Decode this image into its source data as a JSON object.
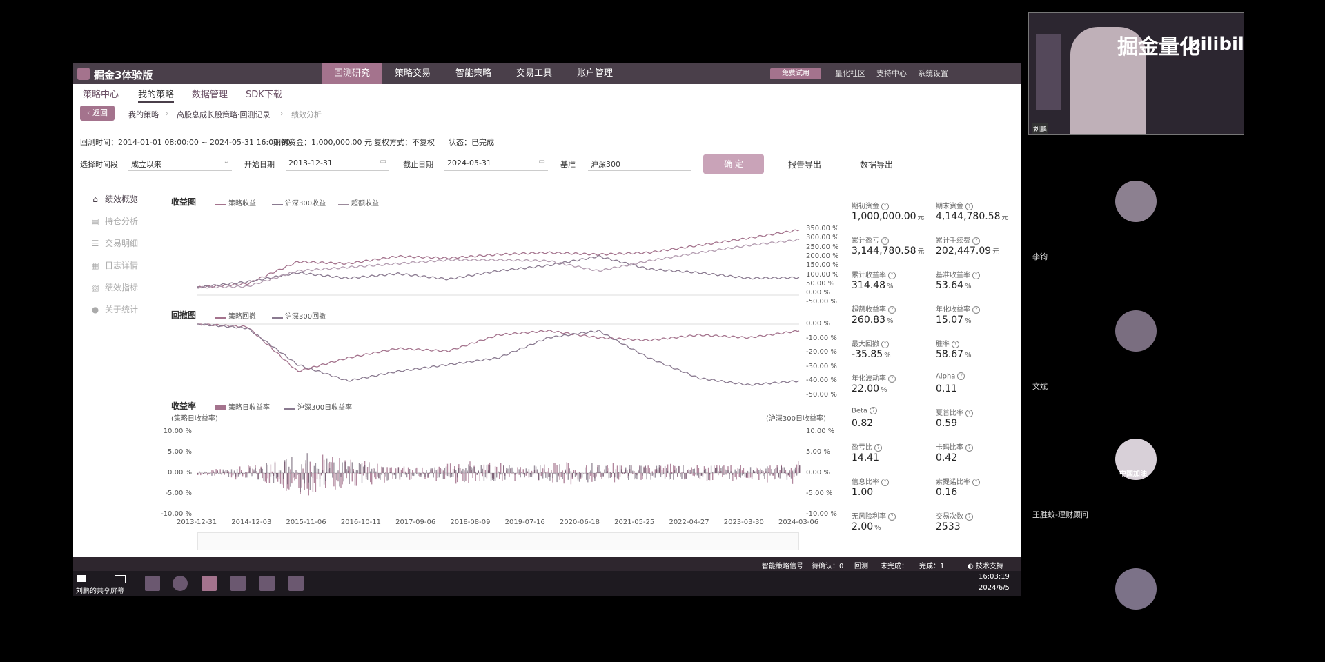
{
  "app": {
    "title": "掘金3体验版",
    "nav": [
      "回测研究",
      "策略交易",
      "智能策略",
      "交易工具",
      "账户管理"
    ],
    "live_button": "免费试用",
    "top_links": [
      "量化社区",
      "支持中心",
      "系统设置"
    ]
  },
  "subnav": [
    "策略中心",
    "我的策略",
    "数据管理",
    "SDK下载"
  ],
  "back_label": "返回",
  "breadcrumb": [
    "我的策略",
    "高股息成长股策略·回测记录",
    "绩效分析"
  ],
  "info": {
    "period": "回测时间：2014-01-01 08:00:00 ~ 2024-05-31 16:00:00",
    "capital": "期初资金：1,000,000.00 元",
    "reinvest": "复权方式：不复权",
    "status": "状态：已完成"
  },
  "filters": {
    "range_label": "选择时间段",
    "range_value": "成立以来",
    "start_label": "开始日期",
    "start_value": "2013-12-31",
    "end_label": "截止日期",
    "end_value": "2024-05-31",
    "bench_label": "基准",
    "bench_value": "沪深300",
    "ok": "确 定",
    "export_report": "报告导出",
    "export_data": "数据导出"
  },
  "sidebar": [
    "绩效概览",
    "持仓分析",
    "交易明细",
    "日志详情",
    "绩效指标",
    "关于统计"
  ],
  "charts": {
    "returns": {
      "title": "收益图",
      "legend": [
        "策略收益",
        "沪深300收益",
        "超额收益"
      ],
      "yticks": [
        "350.00 %",
        "300.00 %",
        "250.00 %",
        "200.00 %",
        "150.00 %",
        "100.00 %",
        "50.00 %",
        "0.00 %",
        "-50.00 %"
      ]
    },
    "drawdown": {
      "title": "回撤图",
      "legend": [
        "策略回撤",
        "沪深300回撤"
      ],
      "yticks": [
        "0.00 %",
        "-10.00 %",
        "-20.00 %",
        "-30.00 %",
        "-40.00 %",
        "-50.00 %"
      ]
    },
    "daily": {
      "title": "收益率",
      "legend": [
        "策略日收益率",
        "沪深300日收益率"
      ],
      "left_axis": "(策略日收益率)",
      "right_axis": "(沪深300日收益率)",
      "yticks_left": [
        "10.00 %",
        "5.00 %",
        "0.00 %",
        "-5.00 %",
        "-10.00 %"
      ],
      "yticks_right": [
        "10.00 %",
        "5.00 %",
        "0.00 %",
        "-5.00 %",
        "-10.00 %"
      ]
    },
    "xticks": [
      "2013-12-31",
      "2014-12-03",
      "2015-11-06",
      "2016-10-11",
      "2017-09-06",
      "2018-08-09",
      "2019-07-16",
      "2020-06-18",
      "2021-05-25",
      "2022-04-27",
      "2023-03-30",
      "2024-03-06"
    ]
  },
  "chart_data": [
    {
      "type": "line",
      "title": "收益图",
      "x": [
        "2013-12-31",
        "2014-12-03",
        "2015-11-06",
        "2016-10-11",
        "2017-09-06",
        "2018-08-09",
        "2019-07-16",
        "2020-06-18",
        "2021-05-25",
        "2022-04-27",
        "2023-03-30",
        "2024-03-06",
        "2024-05-31"
      ],
      "series": [
        {
          "name": "策略收益",
          "values": [
            0,
            20,
            140,
            130,
            170,
            160,
            180,
            190,
            180,
            190,
            230,
            270,
            314
          ]
        },
        {
          "name": "沪深300收益",
          "values": [
            0,
            30,
            80,
            50,
            75,
            45,
            90,
            120,
            170,
            100,
            80,
            50,
            54
          ]
        },
        {
          "name": "超额收益",
          "values": [
            0,
            5,
            90,
            110,
            130,
            150,
            150,
            145,
            90,
            145,
            190,
            230,
            261
          ]
        }
      ],
      "ylim": [
        -50,
        350
      ]
    },
    {
      "type": "line",
      "title": "回撤图",
      "x": [
        "2013-12-31",
        "2014-12-03",
        "2015-11-06",
        "2016-10-11",
        "2017-09-06",
        "2018-08-09",
        "2019-07-16",
        "2020-06-18",
        "2021-05-25",
        "2022-04-27",
        "2023-03-30",
        "2024-03-06",
        "2024-05-31"
      ],
      "series": [
        {
          "name": "策略回撤",
          "values": [
            0,
            -2,
            -35,
            -25,
            -18,
            -20,
            -8,
            -5,
            -10,
            -12,
            -8,
            -10,
            -5
          ]
        },
        {
          "name": "沪深300回撤",
          "values": [
            0,
            -3,
            -30,
            -42,
            -35,
            -30,
            -25,
            -10,
            -5,
            -25,
            -40,
            -45,
            -42
          ]
        }
      ],
      "ylim": [
        -50,
        0
      ]
    },
    {
      "type": "area",
      "title": "收益率",
      "x": [
        "2013-12-31",
        "2014-12-03",
        "2015-11-06",
        "2016-10-11",
        "2017-09-06",
        "2018-08-09",
        "2019-07-16",
        "2020-06-18",
        "2021-05-25",
        "2022-04-27",
        "2023-03-30",
        "2024-03-06"
      ],
      "series": [
        {
          "name": "策略日收益率",
          "values": [
            0.5,
            2,
            6,
            3,
            1.5,
            3,
            2,
            3,
            2,
            2.5,
            2,
            3
          ]
        },
        {
          "name": "沪深300日收益率",
          "values": [
            0.4,
            1.5,
            5,
            2.5,
            1,
            2.5,
            1.8,
            2.5,
            2,
            2,
            1.5,
            2
          ]
        }
      ],
      "ylim": [
        -10,
        10
      ]
    }
  ],
  "metrics": [
    {
      "label": "期初资金",
      "value": "1,000,000.00",
      "unit": "元"
    },
    {
      "label": "期末资金",
      "value": "4,144,780.58",
      "unit": "元"
    },
    {
      "label": "累计盈亏",
      "value": "3,144,780.58",
      "unit": "元"
    },
    {
      "label": "累计手续费",
      "value": "202,447.09",
      "unit": "元"
    },
    {
      "label": "累计收益率",
      "value": "314.48",
      "unit": "%"
    },
    {
      "label": "基准收益率",
      "value": "53.64",
      "unit": "%"
    },
    {
      "label": "超额收益率",
      "value": "260.83",
      "unit": "%"
    },
    {
      "label": "年化收益率",
      "value": "15.07",
      "unit": "%"
    },
    {
      "label": "最大回撤",
      "value": "-35.85",
      "unit": "%"
    },
    {
      "label": "胜率",
      "value": "58.67",
      "unit": "%"
    },
    {
      "label": "年化波动率",
      "value": "22.00",
      "unit": "%"
    },
    {
      "label": "Alpha",
      "value": "0.11",
      "unit": ""
    },
    {
      "label": "Beta",
      "value": "0.82",
      "unit": ""
    },
    {
      "label": "夏普比率",
      "value": "0.59",
      "unit": ""
    },
    {
      "label": "盈亏比",
      "value": "14.41",
      "unit": ""
    },
    {
      "label": "卡玛比率",
      "value": "0.42",
      "unit": ""
    },
    {
      "label": "信息比率",
      "value": "1.00",
      "unit": ""
    },
    {
      "label": "索提诺比率",
      "value": "0.16",
      "unit": ""
    },
    {
      "label": "无风险利率",
      "value": "2.00",
      "unit": "%"
    },
    {
      "label": "交易次数",
      "value": "2533",
      "unit": ""
    }
  ],
  "status": {
    "signal": "智能策略信号",
    "pending": "待确认：0",
    "backtest": "回测",
    "unfinished": "未完成：",
    "done": "完成：1",
    "support": "技术支持"
  },
  "taskbar": {
    "share": "刘鹏的共享屏幕",
    "time": "16:03:19",
    "date": "2024/6/5"
  },
  "video": {
    "watermark": "掘金量化",
    "brand": "bilibili",
    "presenter": "刘鹏",
    "participants": [
      "李钧",
      "文斌",
      "王胜蛟-理财顾问"
    ],
    "avatar_text": "中国加油"
  },
  "colors": {
    "accent": "#a4738d",
    "dark": "#4a3f4a",
    "line1": "#a4738d",
    "line2": "#8a7a90"
  }
}
